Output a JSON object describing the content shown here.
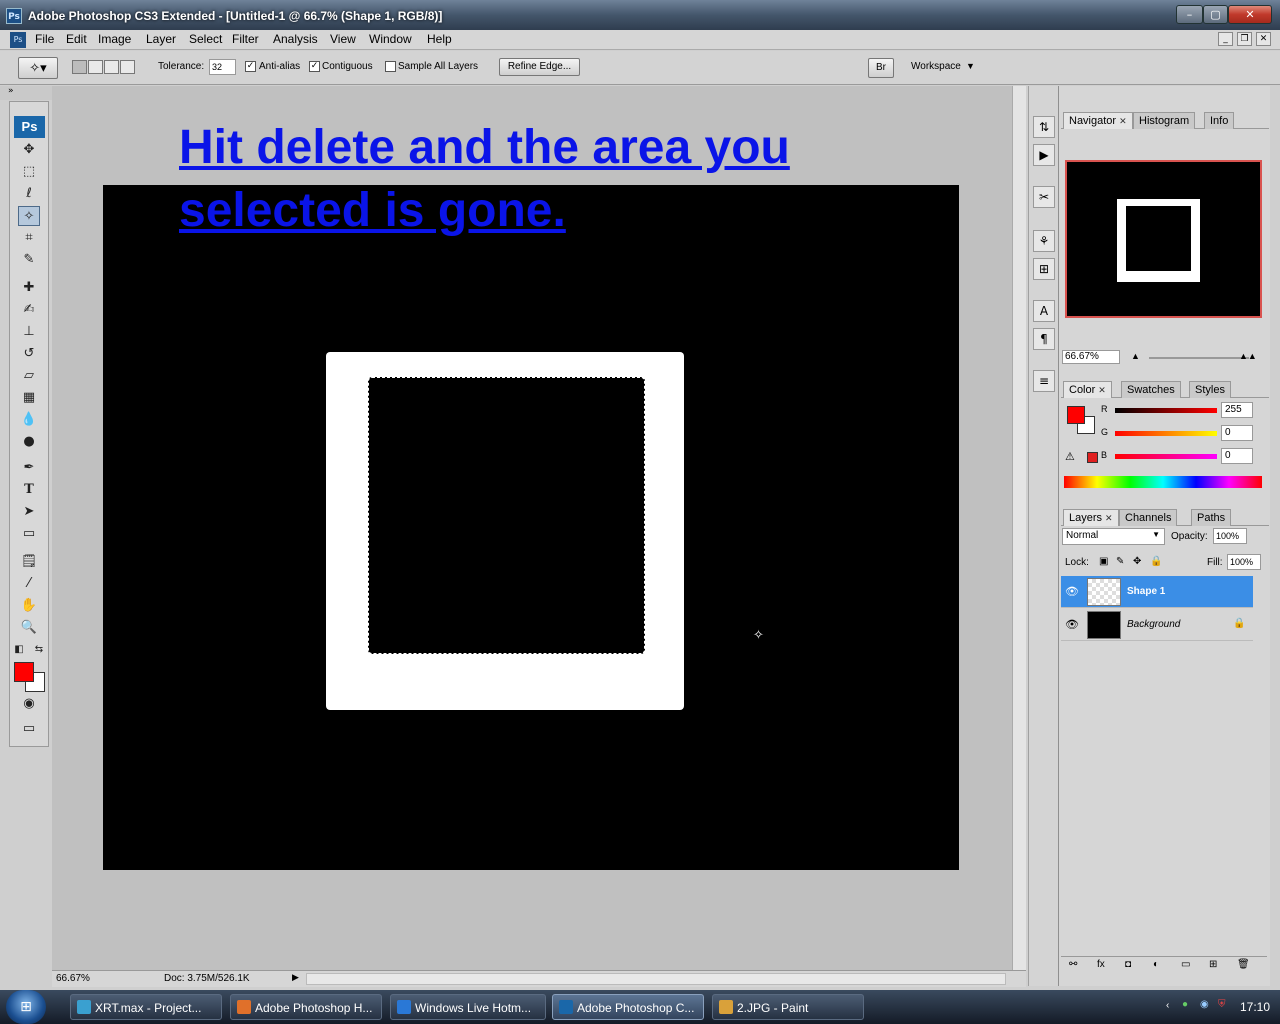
{
  "window": {
    "title": "Adobe Photoshop CS3 Extended - [Untitled-1 @ 66.7% (Shape 1, RGB/8)]",
    "icon_label": "Ps",
    "controls": [
      "minimize-icon",
      "maximize-icon",
      "close-icon"
    ]
  },
  "menu": {
    "items": [
      "File",
      "Edit",
      "Image",
      "Layer",
      "Select",
      "Filter",
      "Analysis",
      "View",
      "Window",
      "Help"
    ]
  },
  "options": {
    "tolerance_label": "Tolerance:",
    "tolerance_value": "32",
    "antialias_label": "Anti-alias",
    "antialias_checked": true,
    "contiguous_label": "Contiguous",
    "contiguous_checked": true,
    "sample_all_label": "Sample All Layers",
    "sample_all_checked": false,
    "refine_edge": "Refine Edge...",
    "workspace": "Workspace"
  },
  "toolbox": {
    "badge": "Ps",
    "tools": [
      "move-tool",
      "marquee-tool",
      "lasso-tool",
      "magic-wand-tool",
      "crop-tool",
      "slice-tool",
      "healing-tool",
      "brush-tool",
      "clone-stamp-tool",
      "history-brush-tool",
      "eraser-tool",
      "gradient-tool",
      "blur-tool",
      "dodge-tool",
      "pen-tool",
      "type-tool",
      "path-selection-tool",
      "shape-tool",
      "notes-tool",
      "eyedropper-tool",
      "hand-tool",
      "zoom-tool"
    ],
    "active_tool": "magic-wand-tool",
    "foreground_color": "#ff0000",
    "background_color": "#ffffff"
  },
  "canvas": {
    "caption": "Hit delete and the area you selected is gone.",
    "caption_color": "#0a14e8"
  },
  "status": {
    "zoom": "66.67%",
    "doc": "Doc: 3.75M/526.1K"
  },
  "navigator": {
    "tabs": [
      "Navigator",
      "Histogram",
      "Info"
    ],
    "zoom": "66.67%"
  },
  "color_panel": {
    "tabs": [
      "Color",
      "Swatches",
      "Styles"
    ],
    "r_label": "R",
    "r_value": "255",
    "g_label": "G",
    "g_value": "0",
    "b_label": "B",
    "b_value": "0"
  },
  "layers_panel": {
    "tabs": [
      "Layers",
      "Channels",
      "Paths"
    ],
    "blend_mode": "Normal",
    "opacity_label": "Opacity:",
    "opacity_value": "100%",
    "lock_label": "Lock:",
    "fill_label": "Fill:",
    "fill_value": "100%",
    "layers": [
      {
        "name": "Shape 1",
        "selected": true,
        "visible": true
      },
      {
        "name": "Background",
        "selected": false,
        "visible": true,
        "locked": true
      }
    ]
  },
  "taskbar": {
    "tasks": [
      {
        "label": "XRT.max     - Project...",
        "active": false,
        "icon_color": "#3aa0d0"
      },
      {
        "label": "Adobe Photoshop H...",
        "active": false,
        "icon_color": "#e0702a"
      },
      {
        "label": "Windows Live Hotm...",
        "active": false,
        "icon_color": "#2a78d6"
      },
      {
        "label": "Adobe Photoshop C...",
        "active": true,
        "icon_color": "#1a67a9"
      },
      {
        "label": "2.JPG - Paint",
        "active": false,
        "icon_color": "#d9a13a"
      }
    ],
    "clock": "17:10"
  }
}
